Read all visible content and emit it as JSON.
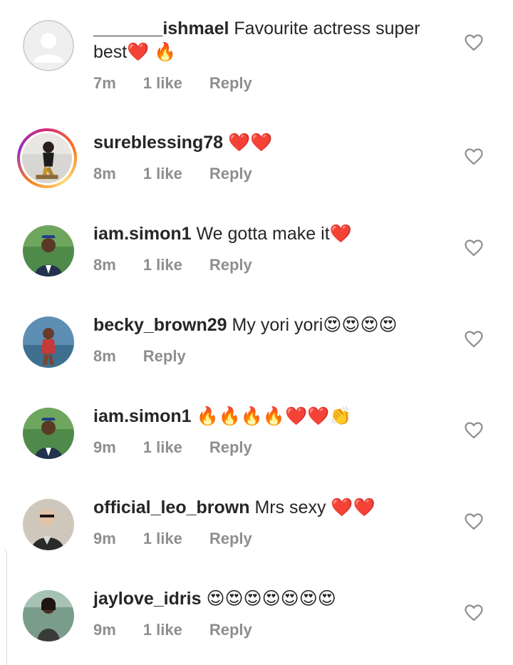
{
  "comments": [
    {
      "username": "_______ishmael",
      "text": "Favourite actress super best❤️ 🔥",
      "time": "7m",
      "likes": "1 like",
      "reply": "Reply",
      "avatar": "default-avatar-icon"
    },
    {
      "username": "sureblessing78",
      "text": "❤️❤️",
      "time": "8m",
      "likes": "1 like",
      "reply": "Reply",
      "avatar": "story-avatar"
    },
    {
      "username": "iam.simon1",
      "text": "We gotta make it❤️",
      "time": "8m",
      "likes": "1 like",
      "reply": "Reply",
      "avatar": "photo-avatar"
    },
    {
      "username": "becky_brown29",
      "text": "My yori yori😍😍😍😍",
      "time": "8m",
      "reply": "Reply",
      "avatar": "photo-avatar"
    },
    {
      "username": "iam.simon1",
      "text": "🔥🔥🔥🔥❤️❤️👏",
      "time": "9m",
      "likes": "1 like",
      "reply": "Reply",
      "avatar": "photo-avatar"
    },
    {
      "username": "official_leo_brown",
      "text": "Mrs sexy ❤️❤️",
      "time": "9m",
      "likes": "1 like",
      "reply": "Reply",
      "avatar": "photo-avatar"
    },
    {
      "username": "jaylove_idris",
      "text": "😍😍😍😍😍😍😍",
      "time": "9m",
      "likes": "1 like",
      "reply": "Reply",
      "avatar": "photo-avatar"
    }
  ],
  "colors": {
    "meta": "#8e8e8e",
    "text": "#262626",
    "heart_outline": "#8e8e8e"
  },
  "icons": {
    "like": "heart-outline-icon"
  }
}
